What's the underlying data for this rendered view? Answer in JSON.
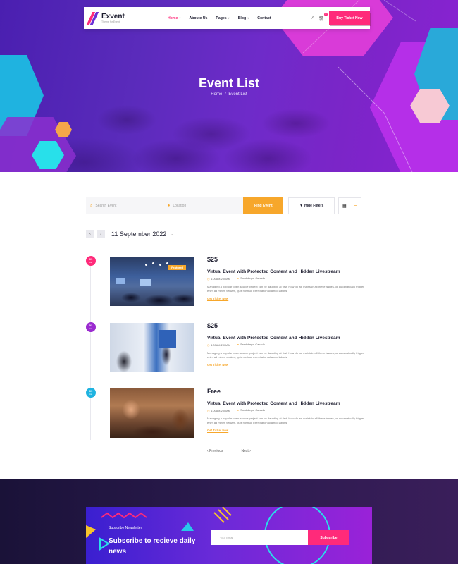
{
  "brand": {
    "name": "Exvent",
    "tagline": "Theme for Event"
  },
  "nav": {
    "items": [
      {
        "label": "Home",
        "has_caret": true,
        "active": true
      },
      {
        "label": "Aboute Us",
        "has_caret": false,
        "active": false
      },
      {
        "label": "Pages",
        "has_caret": true,
        "active": false
      },
      {
        "label": "Blog",
        "has_caret": true,
        "active": false
      },
      {
        "label": "Contact",
        "has_caret": false,
        "active": false
      }
    ],
    "search_icon": "search-icon",
    "cart_icon": "cart-icon",
    "cart_count": "0",
    "cta_label": "Buy Ticket Now"
  },
  "hero": {
    "title": "Event List",
    "breadcrumb": {
      "home": "Home",
      "separator": "/",
      "current": "Event List"
    }
  },
  "search": {
    "event_placeholder": "Search Event",
    "location_placeholder": "Location",
    "find_label": "Find Event",
    "filter_label": "Hide Filters"
  },
  "date_nav": {
    "prev_icon": "chevron-left-icon",
    "next_icon": "chevron-right-icon",
    "current": "11 September 2022"
  },
  "events": [
    {
      "day": "01",
      "month": "Jun",
      "dot_color": "#ff2a7a",
      "price": "$25",
      "badge": "Featured",
      "title": "Virtual Event with Protected Content and Hidden Livestream",
      "time": "1:00AM-2:00AM",
      "location": "Sand diego, Canada",
      "description": "Managing a popular open source project can be daunting at first. How do we maintain all these issues, or automatically trigger enim ad minim veniam, quis nostrud exercitation ullamco laboris",
      "cta": "Get Ticket Now"
    },
    {
      "day": "03",
      "month": "Jun",
      "dot_color": "#9b2bd0",
      "price": "$25",
      "badge": "",
      "title": "Virtual Event with Protected Content and Hidden Livestream",
      "time": "1:00AM-2:00AM",
      "location": "Sand diego, Canada",
      "description": "Managing a popular open source project can be daunting at first. How do we maintain all these issues, or automatically trigger enim ad minim veniam, quis nostrud exercitation ullamco laboris",
      "cta": "Get Ticket Now"
    },
    {
      "day": "01",
      "month": "Jun",
      "dot_color": "#1fb3e0",
      "price": "Free",
      "badge": "",
      "title": "Virtual Event with Protected Content and Hidden Livestream",
      "time": "1:00AM-2:00AM",
      "location": "Sand diego, Canada",
      "description": "Managing a popular open source project can be daunting at first. How do we maintain all these issues, or automatically trigger enim ad minim veniam, quis nostrud exercitation ullamco laboris",
      "cta": "Get Ticket Now"
    }
  ],
  "pagination": {
    "prev": "Previous",
    "next": "Next"
  },
  "newsletter": {
    "label": "Subscribe Newsletter",
    "title": "Subscribe to recieve daily news",
    "placeholder": "Your Email",
    "button": "Subscribe"
  },
  "colors": {
    "primary": "#ff2a7a",
    "accent": "#f7a72b",
    "purple": "#6a2ad8"
  }
}
